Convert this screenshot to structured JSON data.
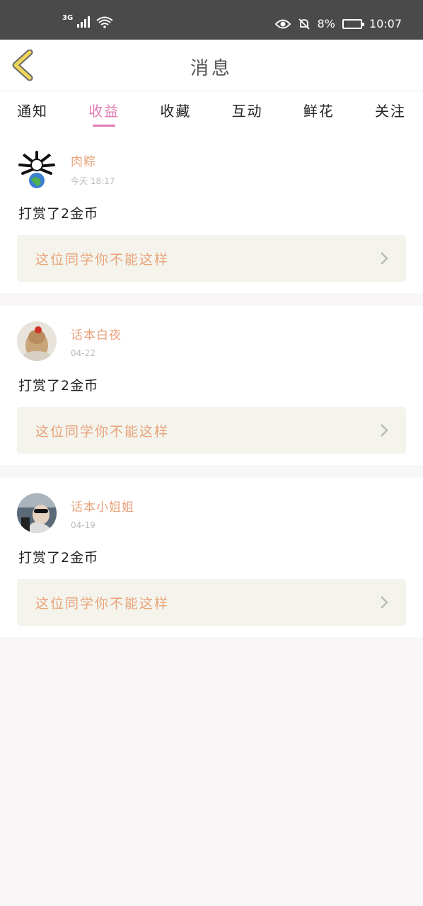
{
  "status_bar": {
    "network": "3G",
    "battery_percent": "8%",
    "time": "10:07"
  },
  "header": {
    "title": "消息"
  },
  "tabs": [
    {
      "label": "通知",
      "active": false
    },
    {
      "label": "收益",
      "active": true
    },
    {
      "label": "收藏",
      "active": false
    },
    {
      "label": "互动",
      "active": false
    },
    {
      "label": "鲜花",
      "active": false
    },
    {
      "label": "关注",
      "active": false
    }
  ],
  "messages": [
    {
      "username": "肉粽",
      "time": "今天 18:17",
      "text": "打赏了2金币",
      "quote": "这位同学你不能这样"
    },
    {
      "username": "话本白夜",
      "time": "04-22",
      "text": "打赏了2金币",
      "quote": "这位同学你不能这样"
    },
    {
      "username": "话本小姐姐",
      "time": "04-19",
      "text": "打赏了2金币",
      "quote": "这位同学你不能这样"
    }
  ],
  "colors": {
    "accent_pink": "#e07ab2",
    "username_orange": "#e9a27a",
    "quote_bg": "#f4f4ec",
    "back_arrow_yellow": "#f0d657"
  }
}
